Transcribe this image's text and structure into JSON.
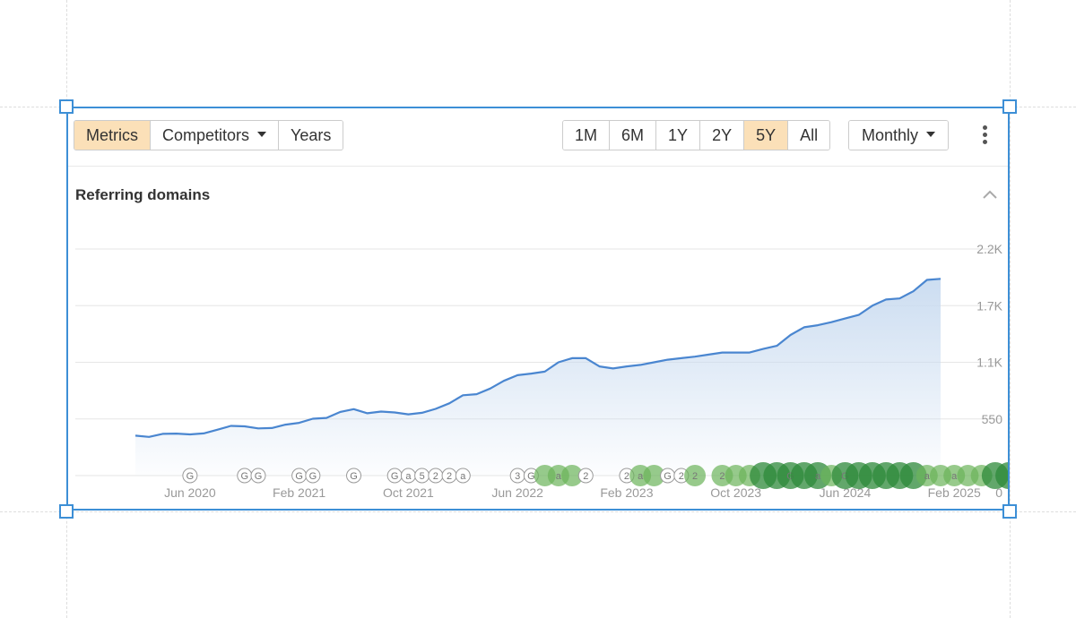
{
  "toolbar": {
    "left_buttons": [
      {
        "label": "Metrics",
        "active": true
      },
      {
        "label": "Competitors",
        "dropdown": true
      },
      {
        "label": "Years"
      }
    ],
    "ranges": [
      {
        "label": "1M"
      },
      {
        "label": "6M"
      },
      {
        "label": "1Y"
      },
      {
        "label": "2Y"
      },
      {
        "label": "5Y",
        "active": true
      },
      {
        "label": "All"
      }
    ],
    "interval": {
      "label": "Monthly"
    },
    "menu_icon": "kebab-menu-icon"
  },
  "title": "Referring domains",
  "collapse_icon": "chevron-up-icon",
  "colors": {
    "frame": "#3d8fd6",
    "active_button": "#fbe0b8",
    "line": "#4a86d0",
    "area": "#c9dbf0",
    "marker_green": "#6bb35a",
    "marker_dark_green": "#2e8a3a"
  },
  "chart_data": {
    "type": "area",
    "title": "Referring domains",
    "ylim": [
      0,
      2200
    ],
    "y_ticks": [
      {
        "value": 0,
        "label": "0"
      },
      {
        "value": 550,
        "label": "550"
      },
      {
        "value": 1100,
        "label": "1.1K"
      },
      {
        "value": 1650,
        "label": "1.7K"
      },
      {
        "value": 2200,
        "label": "2.2K"
      }
    ],
    "x_ticks": [
      "Jun 2020",
      "Feb 2021",
      "Oct 2021",
      "Jun 2022",
      "Feb 2023",
      "Oct 2023",
      "Jun 2024",
      "Feb 2025"
    ],
    "x_start": "2020-02",
    "x_end": "2025-02",
    "grid": true,
    "series": [
      {
        "values": [
          388,
          376,
          405,
          408,
          400,
          410,
          445,
          483,
          478,
          458,
          462,
          495,
          512,
          552,
          560,
          617,
          645,
          605,
          622,
          613,
          595,
          610,
          648,
          702,
          780,
          790,
          845,
          920,
          975,
          990,
          1010,
          1100,
          1140,
          1140,
          1060,
          1040,
          1060,
          1075,
          1100,
          1125,
          1140,
          1155,
          1175,
          1195,
          1195,
          1195,
          1230,
          1260,
          1365,
          1440,
          1460,
          1490,
          1525,
          1560,
          1650,
          1710,
          1720,
          1790,
          1900,
          1910
        ]
      }
    ],
    "annotations": [
      {
        "label": "G",
        "month": 4,
        "kind": "outline"
      },
      {
        "label": "G",
        "month": 8,
        "kind": "outline"
      },
      {
        "label": "G",
        "month": 9,
        "kind": "outline"
      },
      {
        "label": "G",
        "month": 12,
        "kind": "outline"
      },
      {
        "label": "G",
        "month": 13,
        "kind": "outline"
      },
      {
        "label": "G",
        "month": 16,
        "kind": "outline"
      },
      {
        "label": "G",
        "month": 19,
        "kind": "outline"
      },
      {
        "label": "a",
        "month": 20,
        "kind": "outline"
      },
      {
        "label": "5",
        "month": 21,
        "kind": "outline"
      },
      {
        "label": "2",
        "month": 22,
        "kind": "outline"
      },
      {
        "label": "2",
        "month": 23,
        "kind": "outline"
      },
      {
        "label": "a",
        "month": 24,
        "kind": "outline"
      },
      {
        "label": "3",
        "month": 28,
        "kind": "outline"
      },
      {
        "label": "G",
        "month": 29,
        "kind": "outline"
      },
      {
        "label": "",
        "month": 30,
        "kind": "green"
      },
      {
        "label": "a",
        "month": 31,
        "kind": "green"
      },
      {
        "label": "",
        "month": 32,
        "kind": "green"
      },
      {
        "label": "2",
        "month": 33,
        "kind": "outline"
      },
      {
        "label": "2",
        "month": 36,
        "kind": "outline"
      },
      {
        "label": "a",
        "month": 37,
        "kind": "green"
      },
      {
        "label": "",
        "month": 38,
        "kind": "green"
      },
      {
        "label": "G",
        "month": 39,
        "kind": "outline"
      },
      {
        "label": "2",
        "month": 40,
        "kind": "outline"
      },
      {
        "label": "2",
        "month": 41,
        "kind": "green"
      },
      {
        "label": "2",
        "month": 43,
        "kind": "green"
      },
      {
        "label": "",
        "month": 44,
        "kind": "green"
      },
      {
        "label": "",
        "month": 45,
        "kind": "green"
      },
      {
        "label": "",
        "month": 46,
        "kind": "dark"
      },
      {
        "label": "",
        "month": 47,
        "kind": "dark"
      },
      {
        "label": "G",
        "month": 48,
        "kind": "dark"
      },
      {
        "label": "",
        "month": 49,
        "kind": "dark"
      },
      {
        "label": "a",
        "month": 50,
        "kind": "dark"
      },
      {
        "label": "",
        "month": 51,
        "kind": "green"
      },
      {
        "label": "G",
        "month": 52,
        "kind": "dark"
      },
      {
        "label": "",
        "month": 53,
        "kind": "dark"
      },
      {
        "label": "",
        "month": 54,
        "kind": "dark"
      },
      {
        "label": "",
        "month": 55,
        "kind": "dark"
      },
      {
        "label": "",
        "month": 56,
        "kind": "dark"
      },
      {
        "label": "",
        "month": 57,
        "kind": "dark"
      },
      {
        "label": "a",
        "month": 58,
        "kind": "green"
      },
      {
        "label": "",
        "month": 59,
        "kind": "green"
      },
      {
        "label": "a",
        "month": 60,
        "kind": "green"
      },
      {
        "label": "",
        "month": 61,
        "kind": "green"
      },
      {
        "label": "",
        "month": 62,
        "kind": "green"
      },
      {
        "label": "",
        "month": 63,
        "kind": "dark"
      },
      {
        "label": "",
        "month": 64,
        "kind": "dark"
      },
      {
        "label": "2",
        "month": 65,
        "kind": "outline"
      },
      {
        "label": "",
        "month": 67,
        "kind": "green"
      },
      {
        "label": "a",
        "month": 68,
        "kind": "green"
      },
      {
        "label": "a",
        "month": 69,
        "kind": "green"
      },
      {
        "label": "2",
        "month": 70,
        "kind": "green"
      },
      {
        "label": "",
        "month": 71,
        "kind": "green"
      },
      {
        "label": "",
        "month": 72,
        "kind": "green"
      }
    ]
  }
}
